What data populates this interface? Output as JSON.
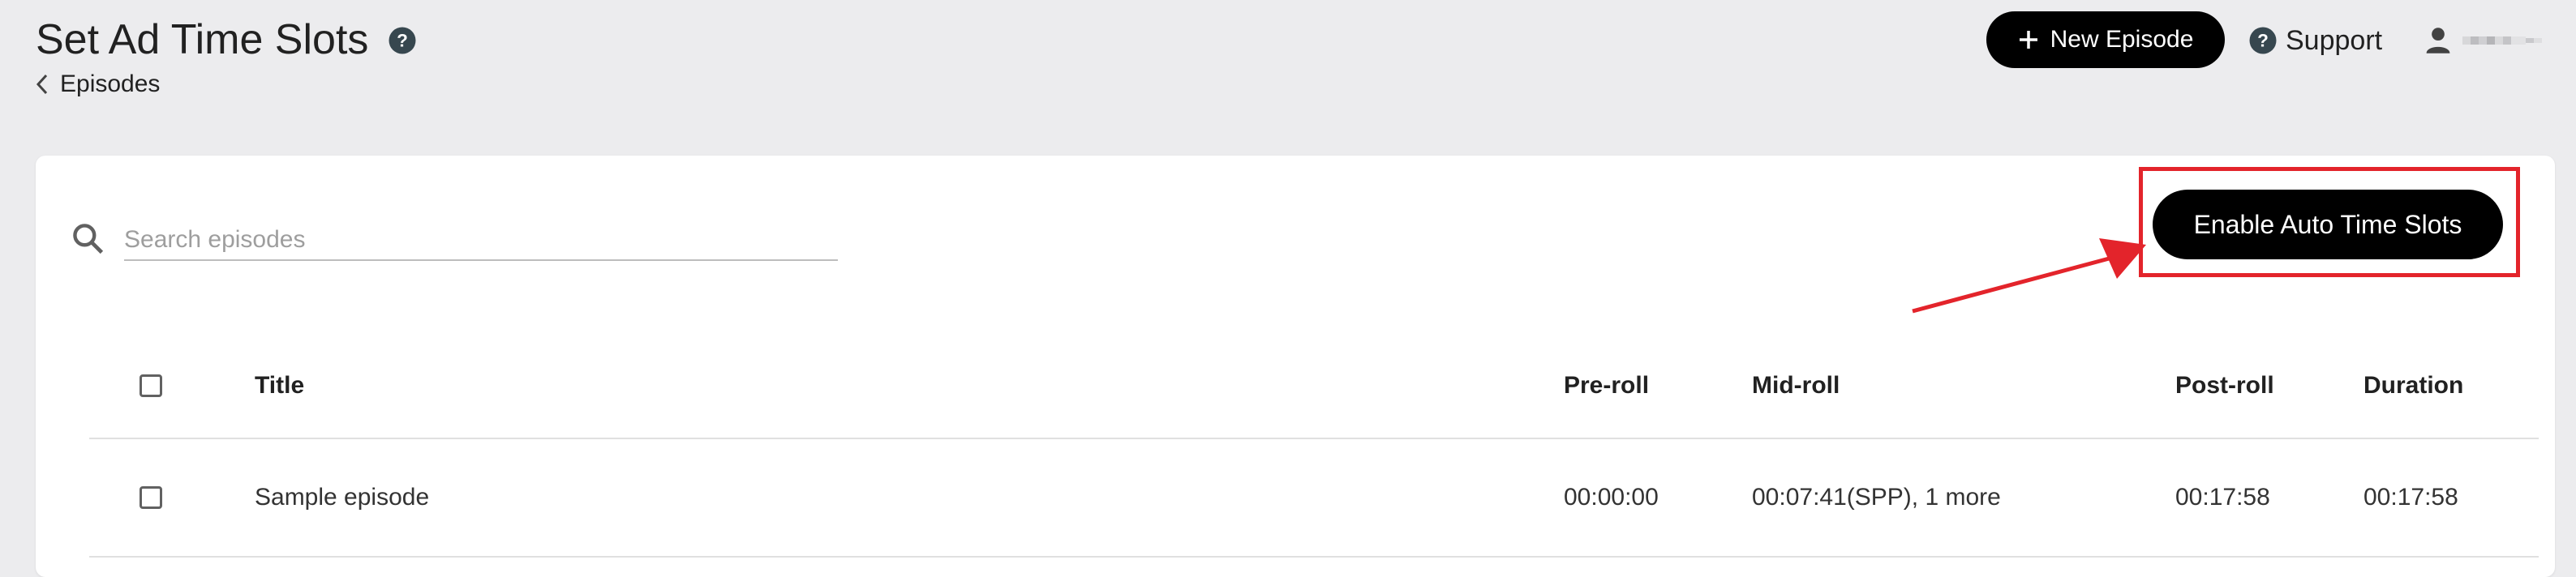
{
  "header": {
    "title": "Set Ad Time Slots",
    "help_icon": "question-circle-icon",
    "breadcrumb_label": "Episodes",
    "new_episode_label": "New Episode",
    "support_label": "Support",
    "user_icon": "person-icon"
  },
  "toolbar": {
    "search_placeholder": "Search episodes",
    "search_value": "",
    "enable_auto_label": "Enable Auto Time Slots"
  },
  "table": {
    "columns": {
      "title": "Title",
      "pre_roll": "Pre-roll",
      "mid_roll": "Mid-roll",
      "post_roll": "Post-roll",
      "duration": "Duration"
    },
    "rows": [
      {
        "title": "Sample episode",
        "pre_roll": "00:00:00",
        "mid_roll": "00:07:41(SPP), 1 more",
        "post_roll": "00:17:58",
        "duration": "00:17:58"
      }
    ]
  },
  "colors": {
    "background": "#ececee",
    "primary_button": "#000000",
    "annotation_red": "#e3242b"
  }
}
